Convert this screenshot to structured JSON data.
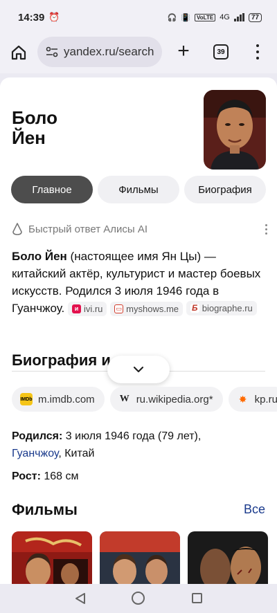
{
  "status_bar": {
    "time": "14:39",
    "network": "4G",
    "volte": "VoLTE",
    "battery": "77"
  },
  "browser": {
    "url": "yandex.ru/search",
    "tab_count": "39"
  },
  "entity": {
    "name_line1": "Боло",
    "name_line2": "Йен"
  },
  "tabs": [
    {
      "label": "Главное",
      "active": true
    },
    {
      "label": "Фильмы",
      "active": false
    },
    {
      "label": "Биография",
      "active": false
    }
  ],
  "alice": {
    "label": "Быстрый ответ Алисы AI"
  },
  "answer": {
    "name": "Боло Йен",
    "text": " (настоящее имя Ян Цы) — китайский актёр, культурист и мастер боевых искусств. Родился 3 июля 1946 года в Гуанчжоу.",
    "sources": [
      "ivi.ru",
      "myshows.me",
      "biographe.ru"
    ]
  },
  "biography": {
    "title": "Биография и карьера",
    "visible_title": "Биография и"
  },
  "links": [
    {
      "label": "m.imdb.com",
      "icon": "imdb-icon"
    },
    {
      "label": "ru.wikipedia.org*",
      "icon": "wikipedia-icon"
    },
    {
      "label": "kp.ru",
      "icon": "kinopoisk-icon"
    }
  ],
  "facts": {
    "born_label": "Родился:",
    "born_value": " 3 июля 1946 года (79 лет),",
    "born_city": "Гуанчжоу",
    "born_country": ", Китай",
    "height_label": "Рост:",
    "height_value": " 168 см"
  },
  "films": {
    "title": "Фильмы",
    "all_label": "Все"
  },
  "colors": {
    "active_pill": "#4d4d4d",
    "link": "#1a3a8c",
    "imdb": "#f5c518"
  }
}
